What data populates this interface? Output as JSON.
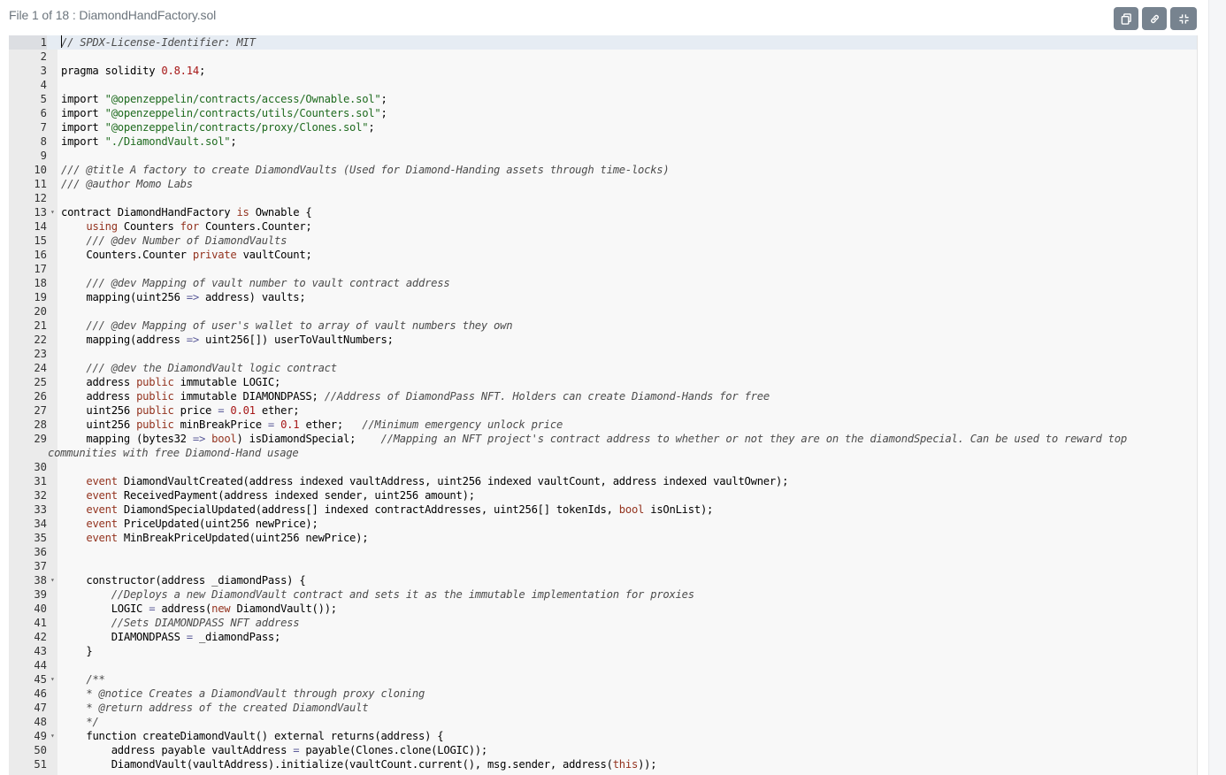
{
  "header": {
    "title": "File 1 of 18 : DiamondHandFactory.sol"
  },
  "toolbar": {
    "buttons": [
      {
        "name": "copy-button",
        "icon": "copy-icon",
        "label": "Copy"
      },
      {
        "name": "link-button",
        "icon": "link-icon",
        "label": "Link"
      },
      {
        "name": "collapse-button",
        "icon": "collapse-icon",
        "label": "Collapse"
      }
    ]
  },
  "colors": {
    "button_bg": "#77838f",
    "editor_bg": "#f8f8f8",
    "gutter_bg": "#ebebeb",
    "active_line_bg": "#e6ecf3",
    "comment": "#4c4c4c",
    "keyword": "#93331f",
    "string": "#1f6b1f",
    "number": "#a61717"
  },
  "editor": {
    "active_line": 1,
    "lines": [
      {
        "n": 1,
        "t": [
          [
            "c",
            "// SPDX-License-Identifier: MIT"
          ]
        ]
      },
      {
        "n": 2,
        "t": []
      },
      {
        "n": 3,
        "t": [
          [
            "p",
            "pragma solidity "
          ],
          [
            "n",
            "0.8.14"
          ],
          [
            "p",
            ";"
          ]
        ]
      },
      {
        "n": 4,
        "t": []
      },
      {
        "n": 5,
        "t": [
          [
            "p",
            "import "
          ],
          [
            "s",
            "\"@openzeppelin/contracts/access/Ownable.sol\""
          ],
          [
            "p",
            ";"
          ]
        ]
      },
      {
        "n": 6,
        "t": [
          [
            "p",
            "import "
          ],
          [
            "s",
            "\"@openzeppelin/contracts/utils/Counters.sol\""
          ],
          [
            "p",
            ";"
          ]
        ]
      },
      {
        "n": 7,
        "t": [
          [
            "p",
            "import "
          ],
          [
            "s",
            "\"@openzeppelin/contracts/proxy/Clones.sol\""
          ],
          [
            "p",
            ";"
          ]
        ]
      },
      {
        "n": 8,
        "t": [
          [
            "p",
            "import "
          ],
          [
            "s",
            "\"./DiamondVault.sol\""
          ],
          [
            "p",
            ";"
          ]
        ]
      },
      {
        "n": 9,
        "t": []
      },
      {
        "n": 10,
        "t": [
          [
            "c",
            "/// @title A factory to create DiamondVaults (Used for Diamond-Handing assets through time-locks)"
          ]
        ]
      },
      {
        "n": 11,
        "t": [
          [
            "c",
            "/// @author Momo Labs"
          ]
        ]
      },
      {
        "n": 12,
        "t": []
      },
      {
        "n": 13,
        "fold": true,
        "t": [
          [
            "p",
            "contract DiamondHandFactory "
          ],
          [
            "k",
            "is"
          ],
          [
            "p",
            " Ownable {"
          ]
        ]
      },
      {
        "n": 14,
        "t": [
          [
            "p",
            "    "
          ],
          [
            "k",
            "using"
          ],
          [
            "p",
            " Counters "
          ],
          [
            "k",
            "for"
          ],
          [
            "p",
            " Counters.Counter;"
          ]
        ]
      },
      {
        "n": 15,
        "t": [
          [
            "p",
            "    "
          ],
          [
            "c",
            "/// @dev Number of DiamondVaults"
          ]
        ]
      },
      {
        "n": 16,
        "t": [
          [
            "p",
            "    Counters.Counter "
          ],
          [
            "k",
            "private"
          ],
          [
            "p",
            " vaultCount;"
          ]
        ]
      },
      {
        "n": 17,
        "t": []
      },
      {
        "n": 18,
        "t": [
          [
            "p",
            "    "
          ],
          [
            "c",
            "/// @dev Mapping of vault number to vault contract address"
          ]
        ]
      },
      {
        "n": 19,
        "t": [
          [
            "p",
            "    mapping(uint256 "
          ],
          [
            "o",
            "=>"
          ],
          [
            "p",
            " address) vaults;"
          ]
        ]
      },
      {
        "n": 20,
        "t": []
      },
      {
        "n": 21,
        "t": [
          [
            "p",
            "    "
          ],
          [
            "c",
            "/// @dev Mapping of user's wallet to array of vault numbers they own"
          ]
        ]
      },
      {
        "n": 22,
        "t": [
          [
            "p",
            "    mapping(address "
          ],
          [
            "o",
            "=>"
          ],
          [
            "p",
            " uint256[]) userToVaultNumbers;"
          ]
        ]
      },
      {
        "n": 23,
        "t": []
      },
      {
        "n": 24,
        "t": [
          [
            "p",
            "    "
          ],
          [
            "c",
            "/// @dev the DiamondVault logic contract"
          ]
        ]
      },
      {
        "n": 25,
        "t": [
          [
            "p",
            "    address "
          ],
          [
            "k",
            "public"
          ],
          [
            "p",
            " immutable LOGIC;"
          ]
        ]
      },
      {
        "n": 26,
        "t": [
          [
            "p",
            "    address "
          ],
          [
            "k",
            "public"
          ],
          [
            "p",
            " immutable DIAMONDPASS; "
          ],
          [
            "c",
            "//Address of DiamondPass NFT. Holders can create Diamond-Hands for free"
          ]
        ]
      },
      {
        "n": 27,
        "t": [
          [
            "p",
            "    uint256 "
          ],
          [
            "k",
            "public"
          ],
          [
            "p",
            " price "
          ],
          [
            "o",
            "="
          ],
          [
            "p",
            " "
          ],
          [
            "n",
            "0.01"
          ],
          [
            "p",
            " ether;"
          ]
        ]
      },
      {
        "n": 28,
        "t": [
          [
            "p",
            "    uint256 "
          ],
          [
            "k",
            "public"
          ],
          [
            "p",
            " minBreakPrice "
          ],
          [
            "o",
            "="
          ],
          [
            "p",
            " "
          ],
          [
            "n",
            "0.1"
          ],
          [
            "p",
            " ether;   "
          ],
          [
            "c",
            "//Minimum emergency unlock price"
          ]
        ]
      },
      {
        "n": 29,
        "t": [
          [
            "p",
            "    mapping (bytes32 "
          ],
          [
            "o",
            "=>"
          ],
          [
            "p",
            " "
          ],
          [
            "k",
            "bool"
          ],
          [
            "p",
            ") isDiamondSpecial;    "
          ],
          [
            "c",
            "//Mapping an NFT project's contract address to whether or not they are on the diamondSpecial. Can be used to reward top"
          ]
        ],
        "wrap": [
          [
            "c",
            "communities with free Diamond-Hand usage"
          ]
        ]
      },
      {
        "n": 30,
        "t": []
      },
      {
        "n": 31,
        "t": [
          [
            "p",
            "    "
          ],
          [
            "k",
            "event"
          ],
          [
            "p",
            " DiamondVaultCreated(address indexed vaultAddress, uint256 indexed vaultCount, address indexed vaultOwner);"
          ]
        ]
      },
      {
        "n": 32,
        "t": [
          [
            "p",
            "    "
          ],
          [
            "k",
            "event"
          ],
          [
            "p",
            " ReceivedPayment(address indexed sender, uint256 amount);"
          ]
        ]
      },
      {
        "n": 33,
        "t": [
          [
            "p",
            "    "
          ],
          [
            "k",
            "event"
          ],
          [
            "p",
            " DiamondSpecialUpdated(address[] indexed contractAddresses, uint256[] tokenIds, "
          ],
          [
            "k",
            "bool"
          ],
          [
            "p",
            " isOnList);"
          ]
        ]
      },
      {
        "n": 34,
        "t": [
          [
            "p",
            "    "
          ],
          [
            "k",
            "event"
          ],
          [
            "p",
            " PriceUpdated(uint256 newPrice);"
          ]
        ]
      },
      {
        "n": 35,
        "t": [
          [
            "p",
            "    "
          ],
          [
            "k",
            "event"
          ],
          [
            "p",
            " MinBreakPriceUpdated(uint256 newPrice);"
          ]
        ]
      },
      {
        "n": 36,
        "t": []
      },
      {
        "n": 37,
        "t": []
      },
      {
        "n": 38,
        "fold": true,
        "t": [
          [
            "p",
            "    constructor(address _diamondPass) {"
          ]
        ]
      },
      {
        "n": 39,
        "t": [
          [
            "p",
            "        "
          ],
          [
            "c",
            "//Deploys a new DiamondVault contract and sets it as the immutable implementation for proxies"
          ]
        ]
      },
      {
        "n": 40,
        "t": [
          [
            "p",
            "        LOGIC "
          ],
          [
            "o",
            "="
          ],
          [
            "p",
            " address("
          ],
          [
            "k",
            "new"
          ],
          [
            "p",
            " DiamondVault());"
          ]
        ]
      },
      {
        "n": 41,
        "t": [
          [
            "p",
            "        "
          ],
          [
            "c",
            "//Sets DIAMONDPASS NFT address"
          ]
        ]
      },
      {
        "n": 42,
        "t": [
          [
            "p",
            "        DIAMONDPASS "
          ],
          [
            "o",
            "="
          ],
          [
            "p",
            " _diamondPass;"
          ]
        ]
      },
      {
        "n": 43,
        "t": [
          [
            "p",
            "    }"
          ]
        ]
      },
      {
        "n": 44,
        "t": []
      },
      {
        "n": 45,
        "fold": true,
        "t": [
          [
            "p",
            "    "
          ],
          [
            "c",
            "/**"
          ]
        ]
      },
      {
        "n": 46,
        "t": [
          [
            "p",
            "    "
          ],
          [
            "c",
            "* @notice Creates a DiamondVault through proxy cloning"
          ]
        ]
      },
      {
        "n": 47,
        "t": [
          [
            "p",
            "    "
          ],
          [
            "c",
            "* @return address of the created DiamondVault"
          ]
        ]
      },
      {
        "n": 48,
        "t": [
          [
            "p",
            "    "
          ],
          [
            "c",
            "*/"
          ]
        ]
      },
      {
        "n": 49,
        "fold": true,
        "t": [
          [
            "p",
            "    function createDiamondVault() external returns(address) {"
          ]
        ]
      },
      {
        "n": 50,
        "t": [
          [
            "p",
            "        address payable vaultAddress "
          ],
          [
            "o",
            "="
          ],
          [
            "p",
            " payable(Clones.clone(LOGIC));"
          ]
        ]
      },
      {
        "n": 51,
        "t": [
          [
            "p",
            "        DiamondVault(vaultAddress).initialize(vaultCount.current(), msg.sender, address("
          ],
          [
            "k",
            "this"
          ],
          [
            "p",
            "));"
          ]
        ]
      }
    ]
  }
}
